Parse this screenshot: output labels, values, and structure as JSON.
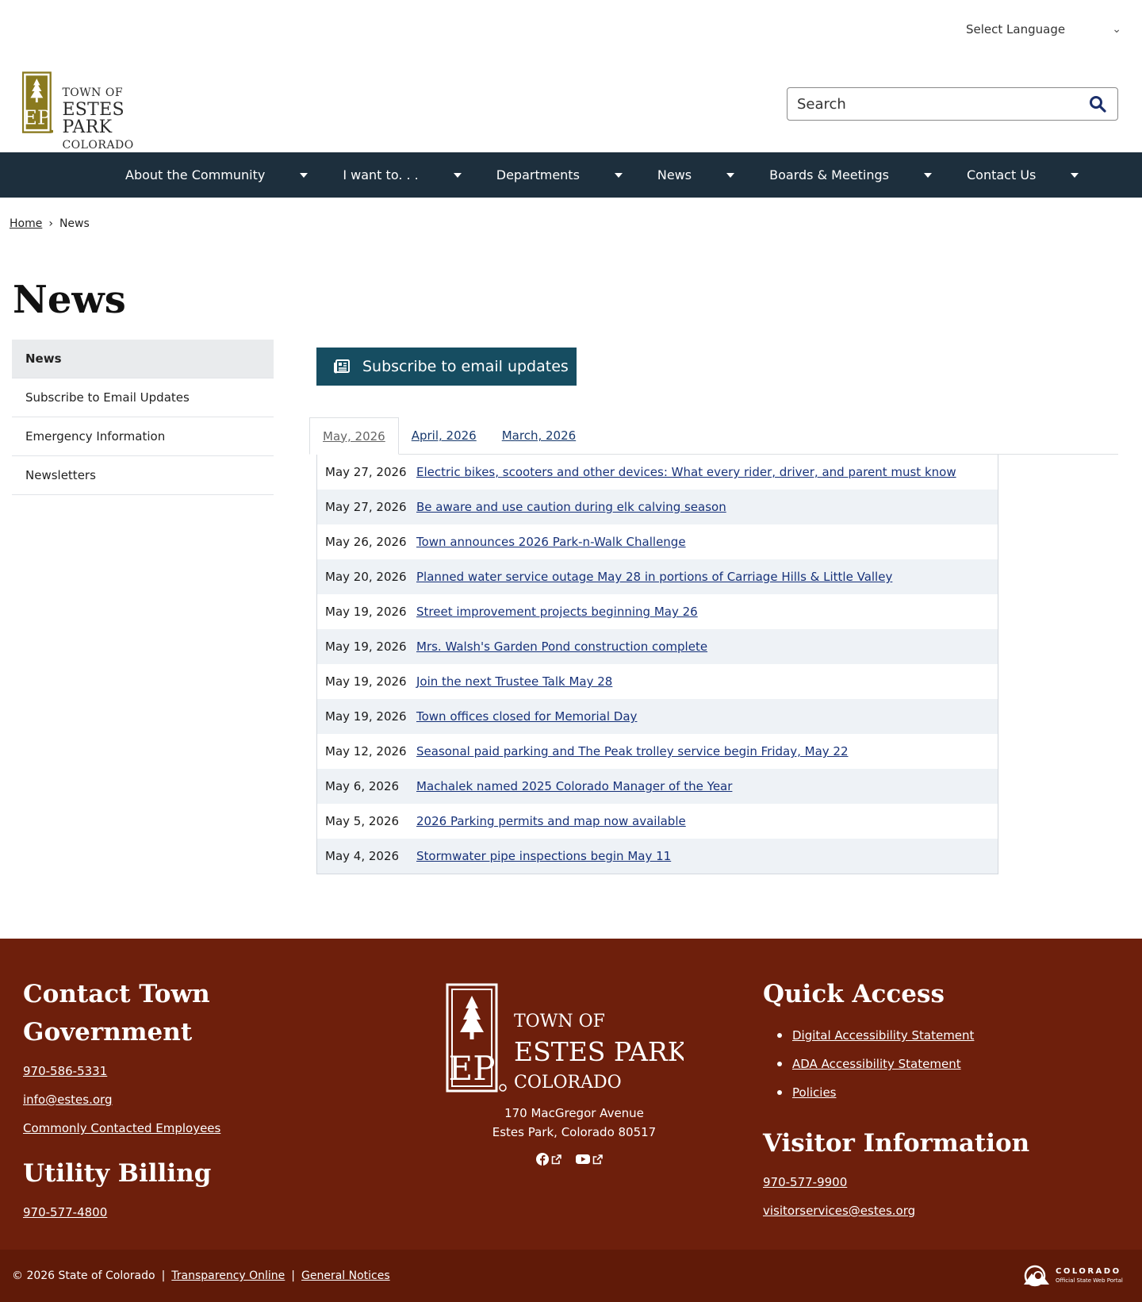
{
  "language": {
    "label": "Select Language"
  },
  "header": {
    "logo": {
      "line1": "TOWN OF",
      "line2": "ESTES PARK",
      "line3": "COLORADO"
    },
    "search": {
      "placeholder": "Search"
    }
  },
  "nav": {
    "items": [
      {
        "label": "About the Community"
      },
      {
        "label": "I want to. . ."
      },
      {
        "label": "Departments"
      },
      {
        "label": "News"
      },
      {
        "label": "Boards & Meetings"
      },
      {
        "label": "Contact Us"
      }
    ]
  },
  "breadcrumb": {
    "home": "Home",
    "separator": "›",
    "current": "News"
  },
  "page": {
    "title": "News"
  },
  "sidebar": {
    "items": [
      {
        "label": "News"
      },
      {
        "label": "Subscribe to Email Updates"
      },
      {
        "label": "Emergency Information"
      },
      {
        "label": "Newsletters"
      }
    ]
  },
  "subscribe": {
    "label": "Subscribe to email updates"
  },
  "tabs": [
    {
      "label": "May, 2026"
    },
    {
      "label": "April, 2026"
    },
    {
      "label": "March, 2026"
    }
  ],
  "news": [
    {
      "date": "May 27, 2026",
      "title": "Electric bikes, scooters and other devices: What every rider, driver, and parent must know"
    },
    {
      "date": "May 27, 2026",
      "title": "Be aware and use caution during elk calving season"
    },
    {
      "date": "May 26, 2026",
      "title": "Town announces 2026 Park-n-Walk Challenge"
    },
    {
      "date": "May 20, 2026",
      "title": "Planned water service outage May 28 in portions of Carriage Hills & Little Valley"
    },
    {
      "date": "May 19, 2026",
      "title": "Street improvement projects beginning May 26"
    },
    {
      "date": "May 19, 2026",
      "title": "Mrs. Walsh's Garden Pond construction complete"
    },
    {
      "date": "May 19, 2026",
      "title": "Join the next Trustee Talk May 28"
    },
    {
      "date": "May 19, 2026",
      "title": "Town offices closed for Memorial Day"
    },
    {
      "date": "May 12, 2026",
      "title": "Seasonal paid parking and The Peak trolley service begin Friday, May 22"
    },
    {
      "date": "May 6, 2026",
      "title": "Machalek named 2025 Colorado Manager of the Year"
    },
    {
      "date": "May 5, 2026",
      "title": "2026 Parking permits and map now available"
    },
    {
      "date": "May 4, 2026",
      "title": "Stormwater pipe inspections begin May 11"
    }
  ],
  "footer": {
    "contact": {
      "heading": "Contact Town Government",
      "phone": "970-586-5331",
      "email": "info@estes.org",
      "employees": "Commonly Contacted Employees"
    },
    "utility": {
      "heading": "Utility Billing",
      "phone": "970-577-4800"
    },
    "logo": {
      "line1": "TOWN OF",
      "line2": "ESTES PARK",
      "line3": "COLORADO"
    },
    "address": {
      "line1": "170 MacGregor Avenue",
      "line2": "Estes Park, Colorado 80517"
    },
    "quick_access": {
      "heading": "Quick Access",
      "links": [
        {
          "label": "Digital Accessibility Statement"
        },
        {
          "label": "ADA Accessibility Statement"
        },
        {
          "label": "Policies"
        }
      ]
    },
    "visitor": {
      "heading": "Visitor Information",
      "phone": "970-577-9900",
      "email": "visitorservices@estes.org"
    }
  },
  "bottom": {
    "copyright": "© 2026 State of Colorado",
    "sep": "|",
    "transparency": "Transparency Online",
    "notices": "General Notices",
    "badge": {
      "name": "COLORADO",
      "sub": "Official State Web Portal"
    }
  },
  "colors": {
    "nav_bg": "#1d2f3d",
    "button_bg": "#164d61",
    "footer_bg": "#6e1f0c",
    "link": "#17327a",
    "logo_gold": "#8a7a1f"
  },
  "icons": {
    "search": "magnifier-icon",
    "subscribe": "newspaper-icon",
    "facebook": "facebook-icon",
    "youtube": "youtube-icon",
    "external": "external-link-icon"
  }
}
